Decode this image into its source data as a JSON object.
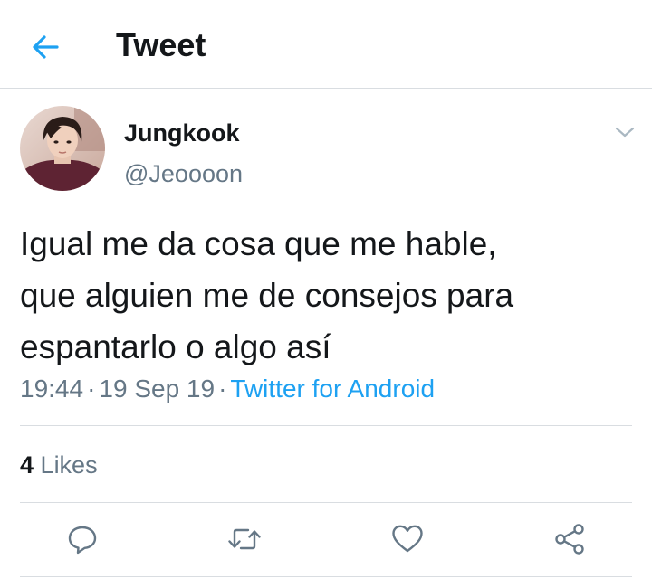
{
  "header": {
    "title": "Tweet",
    "back_icon": "arrow-left-icon",
    "accent_color": "#1da1f2"
  },
  "tweet": {
    "author": {
      "display_name": "Jungkook",
      "handle": "@Jeoooon"
    },
    "text_lines": [
      "Igual me da cosa que me hable,",
      "que alguien me de consejos para",
      "espantarlo o algo así"
    ],
    "time": "19:44",
    "date": "19 Sep 19",
    "separator": "·",
    "source": "Twitter for Android",
    "likes": {
      "count": "4",
      "label": "Likes"
    },
    "actions": [
      {
        "icon": "reply-icon"
      },
      {
        "icon": "retweet-icon"
      },
      {
        "icon": "heart-icon"
      },
      {
        "icon": "share-icon"
      }
    ]
  }
}
